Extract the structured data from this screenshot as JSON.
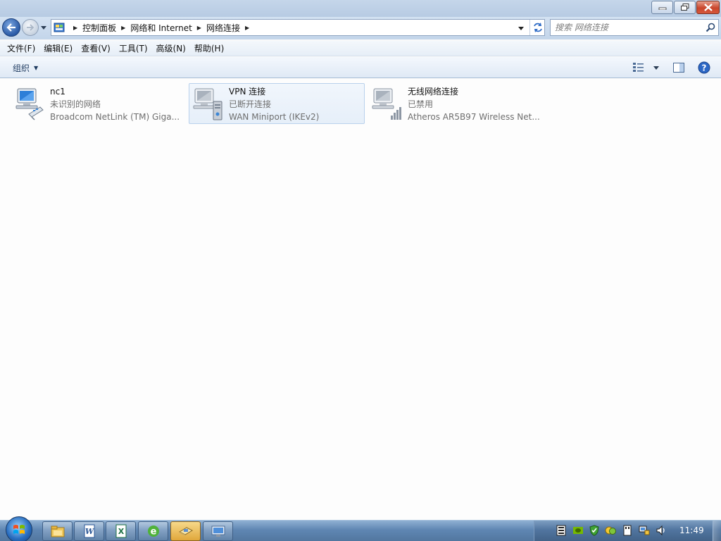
{
  "address": {
    "crumbs": [
      "控制面板",
      "网络和 Internet",
      "网络连接"
    ]
  },
  "search": {
    "placeholder": "搜索 网络连接"
  },
  "menu": {
    "items": [
      "文件(F)",
      "编辑(E)",
      "查看(V)",
      "工具(T)",
      "高级(N)",
      "帮助(H)"
    ]
  },
  "toolbar": {
    "organize_label": "组织"
  },
  "connections": [
    {
      "name": "nc1",
      "status": "未识别的网络",
      "device": "Broadcom NetLink (TM) Giga...",
      "icon": "ethernet-adapter-icon"
    },
    {
      "name": "VPN 连接",
      "status": "已断开连接",
      "device": "WAN Miniport (IKEv2)",
      "icon": "vpn-adapter-icon",
      "selected": true
    },
    {
      "name": "无线网络连接",
      "status": "已禁用",
      "device": "Atheros AR5B97 Wireless Net...",
      "icon": "wireless-adapter-icon"
    }
  ],
  "taskbar": {
    "apps": [
      "explorer-icon",
      "word-icon",
      "excel-icon",
      "ie-icon",
      "network-folder-icon",
      "remote-desktop-icon"
    ],
    "tray_icons": [
      "media-icon",
      "nvidia-icon",
      "shield-icon",
      "chat-icon",
      "usb-icon",
      "network-icon",
      "volume-icon"
    ],
    "clock": "11:49"
  },
  "colors": {
    "accent": "#2a5aa6",
    "selection": "#e6eff9",
    "secondary_text": "#6e6e6e"
  }
}
